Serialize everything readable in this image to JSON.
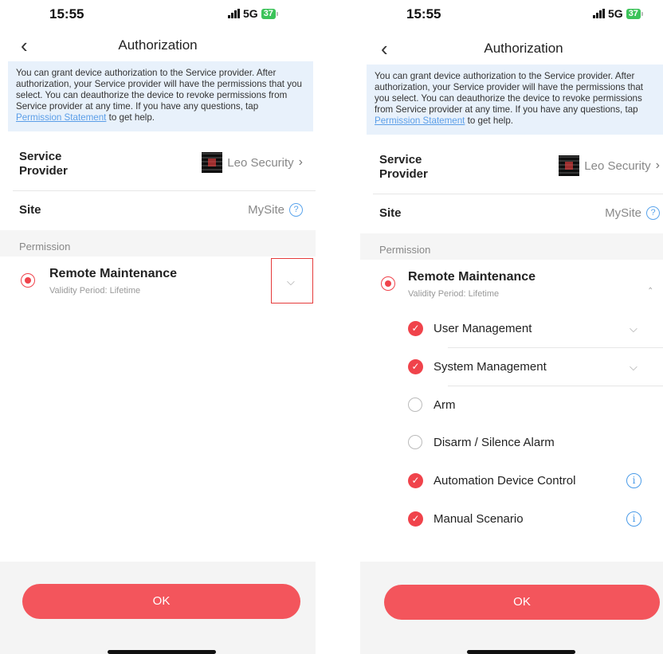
{
  "left": {
    "status": {
      "time": "15:55",
      "network": "5G",
      "battery": "37"
    },
    "nav": {
      "title": "Authorization"
    },
    "notice": {
      "text_before": "You can grant device authorization to the Service provider. After authorization, your Service provider will have the permissions that you select. You can deauthorize the device to revoke permissions from Service provider at any time. If you have any questions, tap ",
      "link": "Permission Statement",
      "text_after": " to get help."
    },
    "service_provider": {
      "label": "Service Provider",
      "value": "Leo Security"
    },
    "site": {
      "label": "Site",
      "value": "MySite"
    },
    "permission_section": "Permission",
    "permission": {
      "title": "Remote Maintenance",
      "validity": "Validity Period:  Lifetime"
    },
    "ok_label": "OK"
  },
  "right": {
    "status": {
      "time": "15:55",
      "network": "5G",
      "battery": "37"
    },
    "nav": {
      "title": "Authorization"
    },
    "notice": {
      "text_before": "You can grant device authorization to the Service provider. After authorization, your Service provider will have the permissions that you select. You can deauthorize the device to revoke permissions from Service provider at any time. If you have any questions, tap ",
      "link": "Permission Statement",
      "text_after": " to get help."
    },
    "service_provider": {
      "label": "Service Provider",
      "value": "Leo Security"
    },
    "site": {
      "label": "Site",
      "value": "MySite"
    },
    "permission_section": "Permission",
    "permission": {
      "title": "Remote Maintenance",
      "validity": "Validity Period:  Lifetime"
    },
    "sub_permissions": [
      {
        "label": "User Management",
        "checked": true
      },
      {
        "label": "System Management",
        "checked": true
      },
      {
        "label": "Arm",
        "checked": false
      },
      {
        "label": "Disarm / Silence Alarm",
        "checked": false
      },
      {
        "label": "Automation Device Control",
        "checked": true
      },
      {
        "label": "Manual Scenario",
        "checked": true
      }
    ],
    "ok_label": "OK"
  },
  "colors": {
    "accent": "#f0434b",
    "ok_button": "#f3555c",
    "notice_bg": "#e8f1fb",
    "link": "#5b9ee8",
    "info_icon": "#4a9be8"
  },
  "icons": {
    "back": "chevron-left-icon",
    "expand": "chevron-down-icon",
    "collapse": "chevron-up-icon",
    "help": "question-circle-icon",
    "info": "info-circle-icon",
    "checked": "check-circle-icon"
  }
}
